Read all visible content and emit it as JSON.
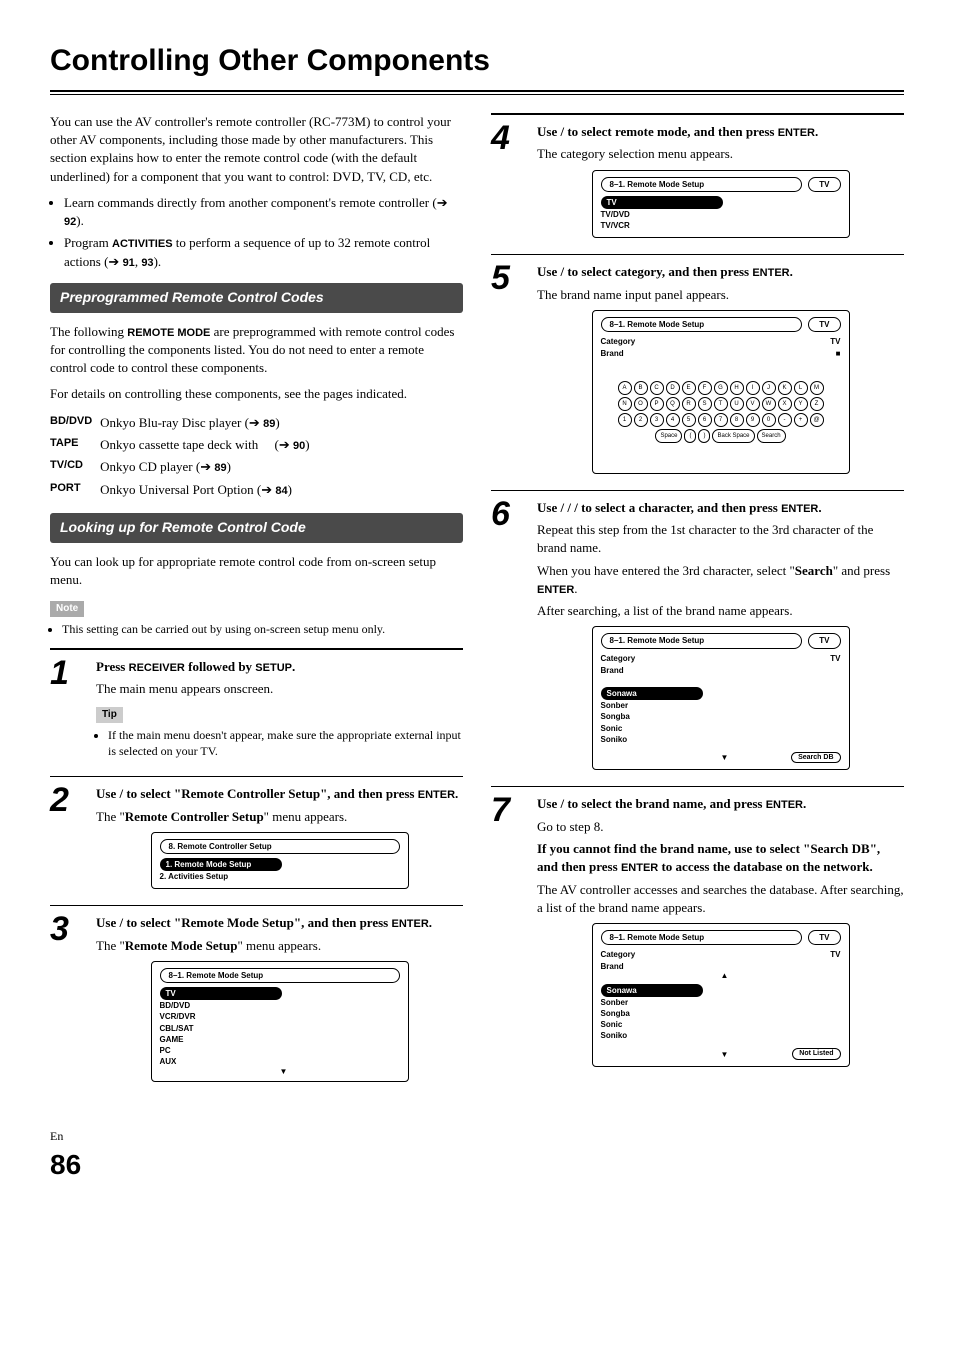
{
  "title": "Controlling Other Components",
  "intro": "You can use the AV controller's remote controller (RC-773M) to control your other AV components, including those made by other manufacturers. This section explains how to enter the remote control code (with the default underlined) for a component that you want to control: DVD, TV, CD, etc.",
  "intro_bullets": [
    {
      "text_a": "Learn commands directly from another component's remote controller (",
      "ref": "92",
      "text_b": ")."
    },
    {
      "text_a": "Program ",
      "bold": "ACTIVITIES",
      "text_c": " to perform a sequence of up to 32 remote control actions (",
      "ref": "91",
      "ref2": "93",
      "text_b": ")."
    }
  ],
  "section_preprog": {
    "heading": "Preprogrammed Remote Control Codes",
    "para1_a": "The following ",
    "para1_bold": "REMOTE MODE",
    "para1_b": " are preprogrammed with remote control codes for controlling the components listed. You do not need to enter a remote control code to control these components.",
    "para2": "For details on controlling these components, see the pages indicated.",
    "rows": [
      {
        "k": "BD/DVD",
        "v": "Onkyo Blu-ray Disc player (",
        "ref": "89",
        "tail": ")"
      },
      {
        "k": "TAPE",
        "v": "Onkyo cassette tape deck with ",
        "ref": "90",
        "tail": ")",
        "note_paren": "("
      },
      {
        "k": "TV/CD",
        "v": "Onkyo CD player (",
        "ref": "89",
        "tail": ")"
      },
      {
        "k": "PORT",
        "v": "Onkyo Universal Port Option (",
        "ref": "84",
        "tail": ")"
      }
    ]
  },
  "section_lookup": {
    "heading": "Looking up for Remote Control Code",
    "para": "You can look up for appropriate remote control code from on-screen setup menu.",
    "note_label": "Note",
    "note_item": "This setting can be carried out by using on-screen setup menu only."
  },
  "tip_label": "Tip",
  "steps_left": [
    {
      "n": "1",
      "lead_a": "Press ",
      "lead_b1": "RECEIVER",
      "lead_mid": " followed by ",
      "lead_b2": "SETUP",
      "lead_tail": ".",
      "after": "The main menu appears onscreen.",
      "tip": "If the main menu doesn't appear, make sure the appropriate external input is selected on your TV."
    },
    {
      "n": "2",
      "lead_a": "Use ",
      "lead_mid": "/",
      "lead_b": " to select \"Remote Controller Setup\", and then press ",
      "lead_b2": "ENTER",
      "lead_tail": ".",
      "after_a": "The \"",
      "after_bold": "Remote Controller Setup",
      "after_b": "\" menu appears.",
      "screen": {
        "hdr": "8.    Remote Controller Setup",
        "items": [
          "1.    Remote Mode Setup",
          "2.    Activities Setup"
        ]
      }
    },
    {
      "n": "3",
      "lead_a": "Use ",
      "lead_mid": "/",
      "lead_b": " to select \"Remote Mode Setup\", and then press ",
      "lead_b2": "ENTER",
      "lead_tail": ".",
      "after_a": "The \"",
      "after_bold": "Remote Mode Setup",
      "after_b": "\" menu appears.",
      "screen": {
        "hdr": "8–1.    Remote Mode Setup",
        "items": [
          "TV",
          "BD/DVD",
          "VCR/DVR",
          "CBL/SAT",
          "GAME",
          "PC",
          "AUX"
        ],
        "hl_index": 0,
        "down": "▼"
      }
    }
  ],
  "steps_right": [
    {
      "n": "4",
      "lead_a": "Use ",
      "lead_mid": "/",
      "lead_b": " to select remote mode, and then press ",
      "lead_b2": "ENTER",
      "lead_tail": ".",
      "after": "The category selection menu appears.",
      "screen": {
        "hdr": "8–1.    Remote Mode Setup",
        "hdr2": "TV",
        "items": [
          "TV",
          "TV/DVD",
          "TV/VCR"
        ],
        "hl_index": 0
      }
    },
    {
      "n": "5",
      "lead_a": "Use ",
      "lead_mid": "/",
      "lead_b": " to select category, and then press ",
      "lead_b2": "ENTER",
      "lead_tail": ".",
      "after": "The brand name input panel appears.",
      "screen": {
        "hdr": "8–1.    Remote Mode Setup",
        "hdr2": "TV",
        "rows": [
          {
            "k": "Category",
            "v": "TV"
          },
          {
            "k": "Brand",
            "v": "■"
          }
        ],
        "keyboard": true
      }
    },
    {
      "n": "6",
      "lead_a": "Use ",
      "lead_mid": "/ / /",
      "lead_b": " to select a character, and then press ",
      "lead_b2": "ENTER",
      "lead_tail": ".",
      "after1": "Repeat this step from the 1st character to the 3rd character of the brand name.",
      "after2_a": "When you have entered the 3rd character, select \"",
      "after2_bold": "Search",
      "after2_b": "\" and press ",
      "after2_b2": "ENTER",
      "after2_tail": ".",
      "after3": "After searching, a list of the brand name appears.",
      "screen": {
        "hdr": "8–1.    Remote Mode Setup",
        "hdr2": "TV",
        "rows": [
          {
            "k": "Category",
            "v": "TV"
          },
          {
            "k": "Brand",
            "v": ""
          }
        ],
        "list": [
          "Sonawa",
          "Sonber",
          "Songba",
          "Sonic",
          "Soniko"
        ],
        "hl_list": 0,
        "down": "▼",
        "btn": "Search DB"
      }
    },
    {
      "n": "7",
      "lead_a": "Use ",
      "lead_mid": "/",
      "lead_b": " to select the brand name, and press ",
      "lead_b2": "ENTER",
      "lead_tail": ".",
      "after1": "Go to step 8.",
      "bold_para_a": "If you cannot find the brand name, use ",
      "bold_para_b": " to select \"Search DB\", and then press ",
      "bold_para_b2": "ENTER",
      "bold_para_c": " to access the database on the network.",
      "after2": "The AV controller accesses and searches the database. After searching, a list of the brand name appears.",
      "screen": {
        "hdr": "8–1.    Remote Mode Setup",
        "hdr2": "TV",
        "rows": [
          {
            "k": "Category",
            "v": "TV"
          },
          {
            "k": "Brand",
            "v": ""
          }
        ],
        "list": [
          "Sonawa",
          "Sonber",
          "Songba",
          "Sonic",
          "Soniko"
        ],
        "hl_list": 0,
        "up": "▲",
        "down": "▼",
        "btn": "Not Listed"
      }
    }
  ],
  "keyboard_rows": [
    [
      "A",
      "B",
      "C",
      "D",
      "E",
      "F",
      "G",
      "H",
      "I",
      "J",
      "K",
      "L",
      "M"
    ],
    [
      "N",
      "O",
      "P",
      "Q",
      "R",
      "S",
      "T",
      "U",
      "V",
      "W",
      "X",
      "Y",
      "Z"
    ],
    [
      "1",
      "2",
      "3",
      "4",
      "5",
      "6",
      "7",
      "8",
      "9",
      "0",
      "-",
      "+",
      "@"
    ]
  ],
  "keyboard_bottom": [
    "Space",
    "(",
    ")",
    "Back Space",
    "Search"
  ],
  "foot": {
    "lang": "En",
    "page": "86"
  }
}
